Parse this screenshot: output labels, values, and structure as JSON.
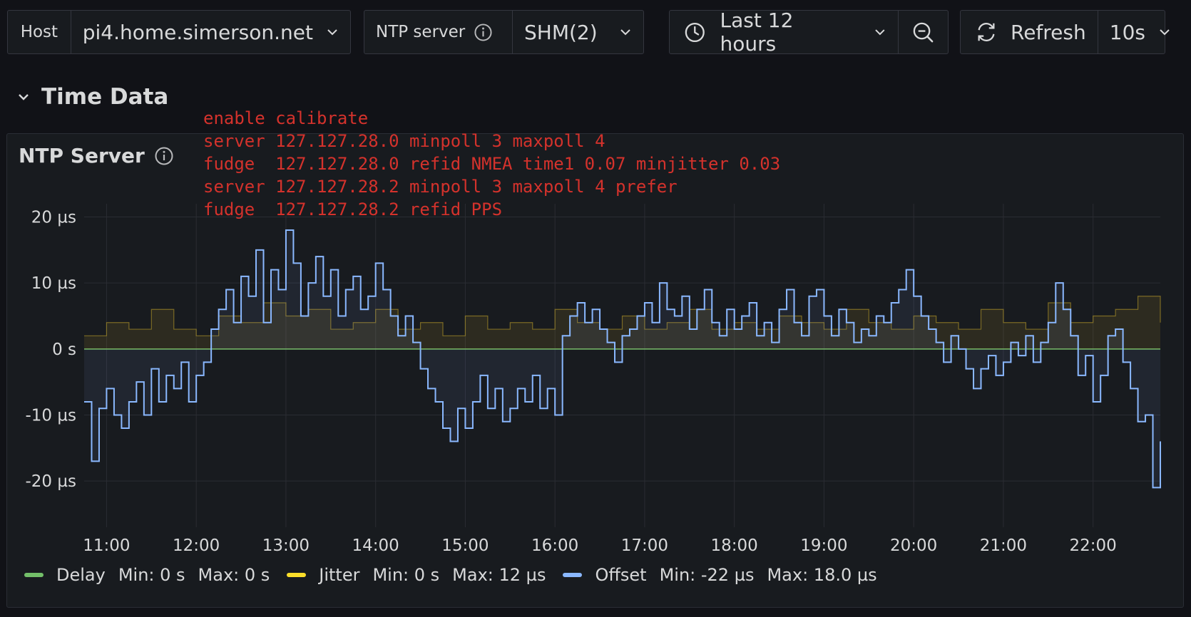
{
  "toolbar": {
    "host_label": "Host",
    "host_value": "pi4.home.simerson.net",
    "ntp_label": "NTP server",
    "ntp_value": "SHM(2)",
    "time_range": "Last 12 hours",
    "refresh_label": "Refresh",
    "refresh_interval": "10s"
  },
  "row": {
    "title": "Time Data"
  },
  "panel": {
    "title": "NTP Server",
    "annotation_lines": [
      "enable calibrate",
      "server 127.127.28.0 minpoll 3 maxpoll 4",
      "fudge  127.127.28.0 refid NMEA time1 0.07 minjitter 0.03",
      "server 127.127.28.2 minpoll 3 maxpoll 4 prefer",
      "fudge  127.127.28.2 refid PPS"
    ]
  },
  "legend": [
    {
      "name": "Delay",
      "min": "Min: 0 s",
      "max": "Max: 0 s",
      "color": "#73bf69"
    },
    {
      "name": "Jitter",
      "min": "Min: 0 s",
      "max": "Max: 12 µs",
      "color": "#fade2a"
    },
    {
      "name": "Offset",
      "min": "Min: -22 µs",
      "max": "Max: 18.0 µs",
      "color": "#8ab8ff"
    }
  ],
  "chart_data": {
    "type": "line",
    "x_start": "10:45",
    "x_end": "22:45",
    "x_ticks": [
      "11:00",
      "12:00",
      "13:00",
      "14:00",
      "15:00",
      "16:00",
      "17:00",
      "18:00",
      "19:00",
      "20:00",
      "21:00",
      "22:00"
    ],
    "y_ticks": [
      "20 µs",
      "10 µs",
      "0 s",
      "-10 µs",
      "-20 µs"
    ],
    "ylim": [
      -27,
      22
    ],
    "ylabel_unit": "µs",
    "series": [
      {
        "name": "Delay",
        "color": "#73bf69",
        "points": [
          [
            "10:45",
            0
          ],
          [
            "22:45",
            0
          ]
        ]
      },
      {
        "name": "Jitter",
        "color": "#c4a52a",
        "points": [
          [
            "10:45",
            2
          ],
          [
            "11:00",
            4
          ],
          [
            "11:15",
            3
          ],
          [
            "11:30",
            6
          ],
          [
            "11:45",
            3
          ],
          [
            "12:00",
            2
          ],
          [
            "12:15",
            5
          ],
          [
            "12:30",
            4
          ],
          [
            "12:45",
            7
          ],
          [
            "13:00",
            5
          ],
          [
            "13:15",
            6
          ],
          [
            "13:30",
            3
          ],
          [
            "13:45",
            4
          ],
          [
            "14:00",
            6
          ],
          [
            "14:15",
            3
          ],
          [
            "14:30",
            4
          ],
          [
            "14:45",
            2
          ],
          [
            "15:00",
            5
          ],
          [
            "15:15",
            3
          ],
          [
            "15:30",
            4
          ],
          [
            "15:45",
            3
          ],
          [
            "16:00",
            6
          ],
          [
            "16:15",
            4
          ],
          [
            "16:30",
            3
          ],
          [
            "16:45",
            5
          ],
          [
            "17:00",
            3
          ],
          [
            "17:15",
            4
          ],
          [
            "17:30",
            6
          ],
          [
            "17:45",
            3
          ],
          [
            "18:00",
            4
          ],
          [
            "18:15",
            3
          ],
          [
            "18:30",
            5
          ],
          [
            "18:45",
            4
          ],
          [
            "19:00",
            3
          ],
          [
            "19:15",
            6
          ],
          [
            "19:30",
            4
          ],
          [
            "19:45",
            3
          ],
          [
            "20:00",
            5
          ],
          [
            "20:15",
            4
          ],
          [
            "20:30",
            3
          ],
          [
            "20:45",
            6
          ],
          [
            "21:00",
            4
          ],
          [
            "21:15",
            3
          ],
          [
            "21:30",
            7
          ],
          [
            "21:45",
            4
          ],
          [
            "22:00",
            5
          ],
          [
            "22:15",
            6
          ],
          [
            "22:30",
            8
          ],
          [
            "22:45",
            4
          ]
        ]
      },
      {
        "name": "Offset",
        "color": "#8ab8ff",
        "points": [
          [
            "10:45",
            -8
          ],
          [
            "10:50",
            -17
          ],
          [
            "10:55",
            -9
          ],
          [
            "11:00",
            -6
          ],
          [
            "11:05",
            -10
          ],
          [
            "11:10",
            -12
          ],
          [
            "11:15",
            -8
          ],
          [
            "11:20",
            -5
          ],
          [
            "11:25",
            -10
          ],
          [
            "11:30",
            -3
          ],
          [
            "11:35",
            -8
          ],
          [
            "11:40",
            -4
          ],
          [
            "11:45",
            -6
          ],
          [
            "11:50",
            -2
          ],
          [
            "11:55",
            -8
          ],
          [
            "12:00",
            -4
          ],
          [
            "12:05",
            -2
          ],
          [
            "12:10",
            3
          ],
          [
            "12:15",
            6
          ],
          [
            "12:20",
            9
          ],
          [
            "12:25",
            4
          ],
          [
            "12:30",
            11
          ],
          [
            "12:35",
            8
          ],
          [
            "12:40",
            15
          ],
          [
            "12:45",
            4
          ],
          [
            "12:50",
            12
          ],
          [
            "12:55",
            9
          ],
          [
            "13:00",
            18
          ],
          [
            "13:05",
            13
          ],
          [
            "13:10",
            5
          ],
          [
            "13:15",
            10
          ],
          [
            "13:20",
            14
          ],
          [
            "13:25",
            8
          ],
          [
            "13:30",
            12
          ],
          [
            "13:35",
            5
          ],
          [
            "13:40",
            9
          ],
          [
            "13:45",
            11
          ],
          [
            "13:50",
            6
          ],
          [
            "13:55",
            8
          ],
          [
            "14:00",
            13
          ],
          [
            "14:05",
            9
          ],
          [
            "14:10",
            5
          ],
          [
            "14:15",
            2
          ],
          [
            "14:20",
            5
          ],
          [
            "14:25",
            1
          ],
          [
            "14:30",
            -3
          ],
          [
            "14:35",
            -6
          ],
          [
            "14:40",
            -8
          ],
          [
            "14:45",
            -12
          ],
          [
            "14:50",
            -14
          ],
          [
            "14:55",
            -9
          ],
          [
            "15:00",
            -12
          ],
          [
            "15:05",
            -8
          ],
          [
            "15:10",
            -4
          ],
          [
            "15:15",
            -9
          ],
          [
            "15:20",
            -6
          ],
          [
            "15:25",
            -11
          ],
          [
            "15:30",
            -9
          ],
          [
            "15:35",
            -6
          ],
          [
            "15:40",
            -8
          ],
          [
            "15:45",
            -4
          ],
          [
            "15:50",
            -9
          ],
          [
            "15:55",
            -6
          ],
          [
            "16:00",
            -10
          ],
          [
            "16:05",
            2
          ],
          [
            "16:10",
            5
          ],
          [
            "16:15",
            7
          ],
          [
            "16:20",
            4
          ],
          [
            "16:25",
            6
          ],
          [
            "16:30",
            3
          ],
          [
            "16:35",
            1
          ],
          [
            "16:40",
            -2
          ],
          [
            "16:45",
            2
          ],
          [
            "16:50",
            3
          ],
          [
            "16:55",
            5
          ],
          [
            "17:00",
            7
          ],
          [
            "17:05",
            4
          ],
          [
            "17:10",
            10
          ],
          [
            "17:15",
            6
          ],
          [
            "17:20",
            5
          ],
          [
            "17:25",
            8
          ],
          [
            "17:30",
            3
          ],
          [
            "17:35",
            6
          ],
          [
            "17:40",
            9
          ],
          [
            "17:45",
            4
          ],
          [
            "17:50",
            2
          ],
          [
            "17:55",
            6
          ],
          [
            "18:00",
            3
          ],
          [
            "18:05",
            5
          ],
          [
            "18:10",
            7
          ],
          [
            "18:15",
            2
          ],
          [
            "18:20",
            4
          ],
          [
            "18:25",
            1
          ],
          [
            "18:30",
            6
          ],
          [
            "18:35",
            9
          ],
          [
            "18:40",
            4
          ],
          [
            "18:45",
            2
          ],
          [
            "18:50",
            8
          ],
          [
            "18:55",
            9
          ],
          [
            "19:00",
            5
          ],
          [
            "19:05",
            2
          ],
          [
            "19:10",
            6
          ],
          [
            "19:15",
            4
          ],
          [
            "19:20",
            1
          ],
          [
            "19:25",
            3
          ],
          [
            "19:30",
            2
          ],
          [
            "19:35",
            5
          ],
          [
            "19:40",
            4
          ],
          [
            "19:45",
            7
          ],
          [
            "19:50",
            9
          ],
          [
            "19:55",
            12
          ],
          [
            "20:00",
            8
          ],
          [
            "20:05",
            5
          ],
          [
            "20:10",
            3
          ],
          [
            "20:15",
            1
          ],
          [
            "20:20",
            -2
          ],
          [
            "20:25",
            2
          ],
          [
            "20:30",
            0
          ],
          [
            "20:35",
            -3
          ],
          [
            "20:40",
            -6
          ],
          [
            "20:45",
            -3
          ],
          [
            "20:50",
            -1
          ],
          [
            "20:55",
            -4
          ],
          [
            "21:00",
            -2
          ],
          [
            "21:05",
            1
          ],
          [
            "21:10",
            -1
          ],
          [
            "21:15",
            2
          ],
          [
            "21:20",
            -2
          ],
          [
            "21:25",
            1
          ],
          [
            "21:30",
            4
          ],
          [
            "21:35",
            10
          ],
          [
            "21:40",
            6
          ],
          [
            "21:45",
            2
          ],
          [
            "21:50",
            -4
          ],
          [
            "21:55",
            -1
          ],
          [
            "22:00",
            -8
          ],
          [
            "22:05",
            -4
          ],
          [
            "22:10",
            2
          ],
          [
            "22:15",
            3
          ],
          [
            "22:20",
            -2
          ],
          [
            "22:25",
            -6
          ],
          [
            "22:30",
            -11
          ],
          [
            "22:35",
            -10
          ],
          [
            "22:40",
            -21
          ],
          [
            "22:45",
            -14
          ]
        ]
      }
    ]
  }
}
